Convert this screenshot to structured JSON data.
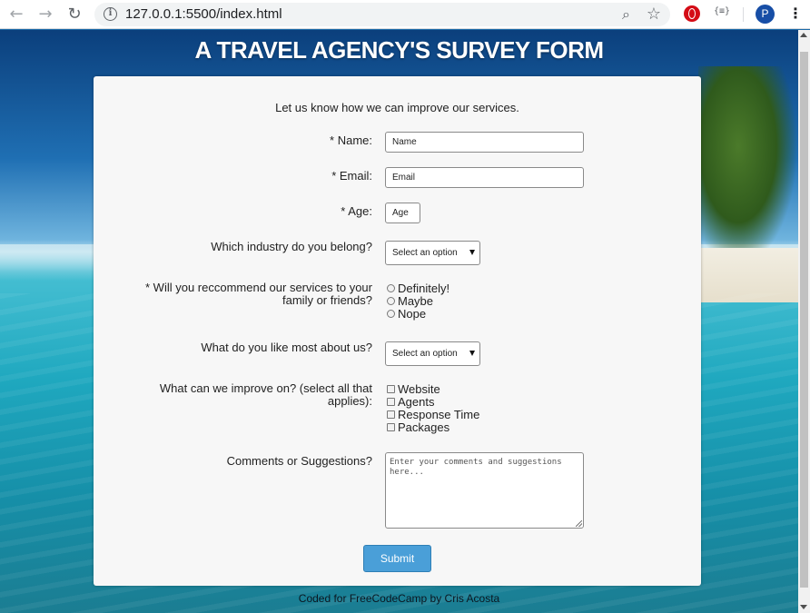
{
  "browser": {
    "url": "127.0.0.1:5500/index.html",
    "avatar_letter": "P",
    "json_ext_label": "{≡}"
  },
  "icons": {
    "back": "back-arrow-icon",
    "forward": "forward-arrow-icon",
    "reload": "reload-icon",
    "info": "info-icon",
    "zoom": "zoom-icon",
    "star": "bookmark-star-icon",
    "opera": "opera-extension-icon",
    "menu": "kebab-menu-icon"
  },
  "page": {
    "title": "A TRAVEL AGENCY'S SURVEY FORM",
    "intro": "Let us know how we can improve our services.",
    "footer": "Coded for FreeCodeCamp by Cris Acosta"
  },
  "form": {
    "name": {
      "label": "* Name:",
      "placeholder": "Name"
    },
    "email": {
      "label": "* Email:",
      "placeholder": "Email"
    },
    "age": {
      "label": "* Age:",
      "placeholder": "Age"
    },
    "industry": {
      "label": "Which industry do you belong?",
      "selected": "Select an option"
    },
    "recommend": {
      "label_line1": "* Will you reccommend our services to your",
      "label_line2": "family or friends?",
      "options": [
        "Definitely!",
        "Maybe",
        "Nope"
      ]
    },
    "like_most": {
      "label": "What do you like most about us?",
      "selected": "Select an option"
    },
    "improve": {
      "label_line1": "What can we improve on? (select all that",
      "label_line2": "applies):",
      "options": [
        "Website",
        "Agents",
        "Response Time",
        "Packages"
      ]
    },
    "comments": {
      "label": "Comments or Suggestions?",
      "placeholder": "Enter your comments and suggestions here..."
    },
    "submit_label": "Submit"
  },
  "colors": {
    "accent": "#4a9fd8",
    "card_bg": "#f7f7f7",
    "title_text": "#ffffff"
  }
}
